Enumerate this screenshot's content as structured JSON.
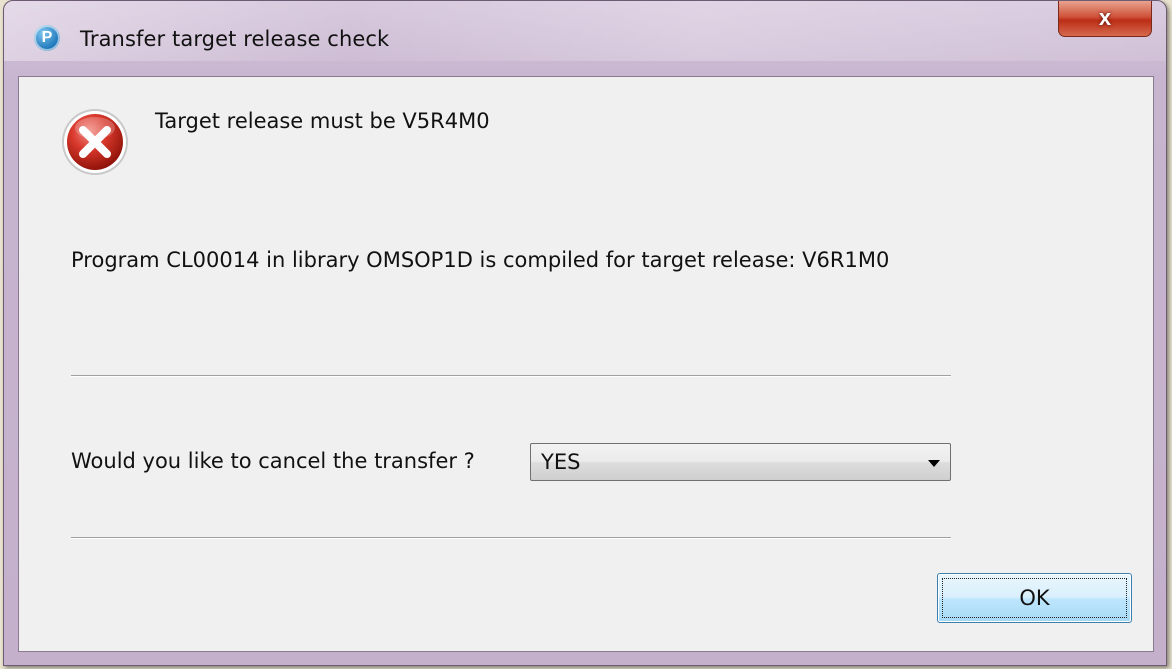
{
  "window": {
    "title": "Transfer target release check",
    "app_icon_glyph": "P",
    "close_glyph": "x"
  },
  "dialog": {
    "icon": "error-icon",
    "main_message": "Target release must be V5R4M0",
    "detail_message": "Program CL00014 in library OMSOP1D is compiled for target release: V6R1M0",
    "question": "Would you like to cancel the transfer ?",
    "cancel_select": {
      "selected": "YES"
    },
    "ok_label": "OK"
  },
  "colors": {
    "error_red": "#c62828",
    "frame": "#cfbed6",
    "close_button": "#c8412a",
    "ok_button": "#bee6fd"
  }
}
